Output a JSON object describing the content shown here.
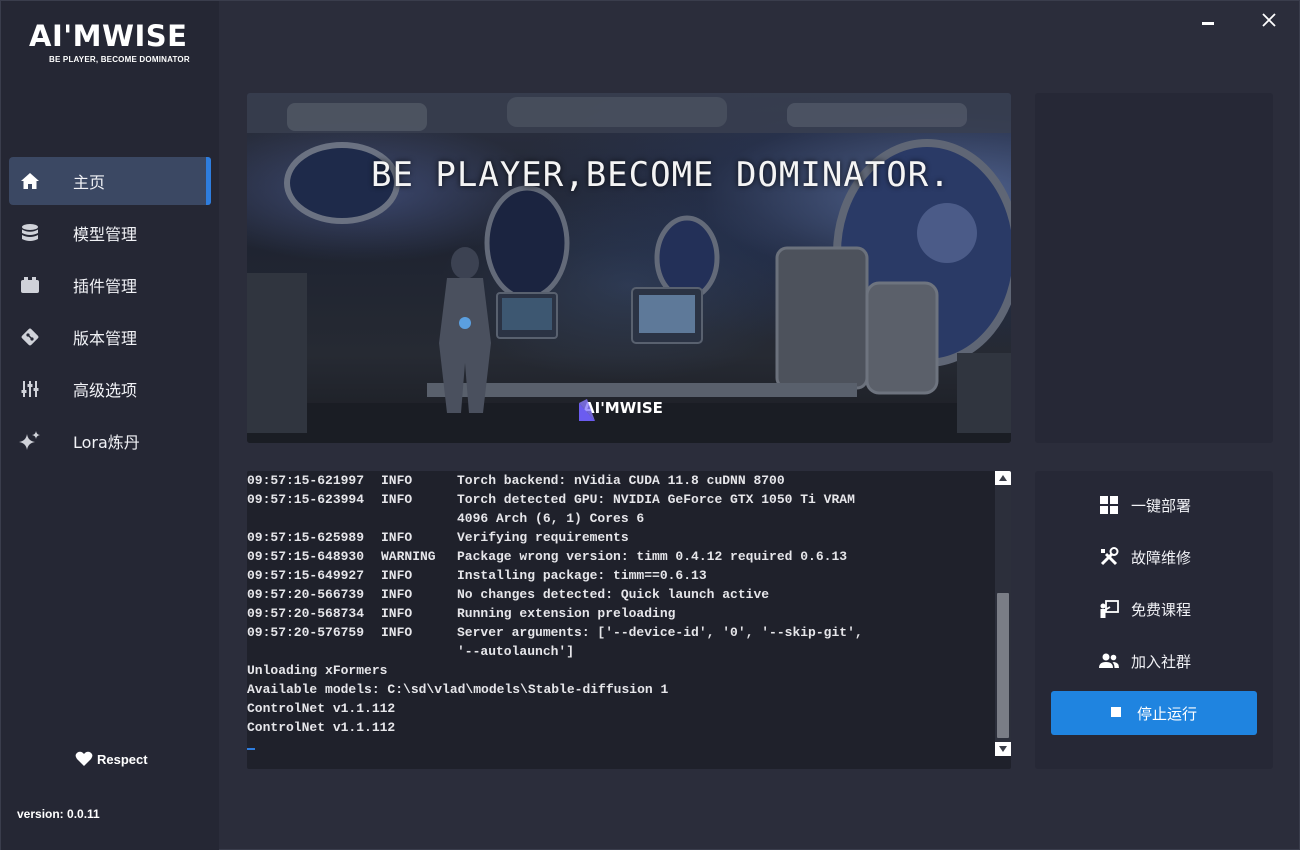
{
  "app": {
    "logo_text": "AI'MWISE",
    "logo_tagline": "BE PLAYER, BECOME DOMINATOR",
    "version": "version: 0.0.11",
    "respect_label": "Respect",
    "accent_color": "#2e7dde"
  },
  "sidebar": {
    "items": [
      {
        "label": "主页",
        "icon": "home-icon",
        "active": true
      },
      {
        "label": "模型管理",
        "icon": "database-icon"
      },
      {
        "label": "插件管理",
        "icon": "plugin-icon"
      },
      {
        "label": "版本管理",
        "icon": "git-icon"
      },
      {
        "label": "高级选项",
        "icon": "sliders-icon"
      },
      {
        "label": "Lora炼丹",
        "icon": "sparkle-icon"
      }
    ]
  },
  "banner": {
    "headline": "BE PLAYER,BECOME DOMINATOR.",
    "logo_text": "AI'MWISE"
  },
  "console": {
    "log_entries": [
      {
        "ts": "09:57:15-621997",
        "level": "INFO",
        "msg": [
          "Torch backend: nVidia CUDA 11.8 cuDNN 8700"
        ]
      },
      {
        "ts": "09:57:15-623994",
        "level": "INFO",
        "msg": [
          "Torch detected GPU: NVIDIA GeForce GTX 1050 Ti VRAM",
          "4096 Arch (6, 1) Cores 6"
        ]
      },
      {
        "ts": "09:57:15-625989",
        "level": "INFO",
        "msg": [
          "Verifying requirements"
        ]
      },
      {
        "ts": "09:57:15-648930",
        "level": "WARNING",
        "msg": [
          "Package wrong version: timm 0.4.12 required 0.6.13"
        ]
      },
      {
        "ts": "09:57:15-649927",
        "level": "INFO",
        "msg": [
          "Installing package: timm==0.6.13"
        ]
      },
      {
        "ts": "09:57:20-566739",
        "level": "INFO",
        "msg": [
          "No changes detected: Quick launch active"
        ]
      },
      {
        "ts": "09:57:20-568734",
        "level": "INFO",
        "msg": [
          "Running extension preloading"
        ]
      },
      {
        "ts": "09:57:20-576759",
        "level": "INFO",
        "msg": [
          "Server arguments: ['--device-id', '0', '--skip-git',",
          "'--autolaunch']"
        ]
      }
    ],
    "plain_lines": [
      "Unloading xFormers",
      "Available models: C:\\sd\\vlad\\models\\Stable-diffusion 1",
      "ControlNet v1.1.112",
      "ControlNet v1.1.112"
    ]
  },
  "actions": {
    "items": [
      {
        "label": "一键部署",
        "icon": "windows-icon"
      },
      {
        "label": "故障维修",
        "icon": "tools-icon"
      },
      {
        "label": "免费课程",
        "icon": "teacher-icon"
      },
      {
        "label": "加入社群",
        "icon": "group-icon"
      }
    ],
    "stop_label": "停止运行",
    "stop_color": "#1f84e0"
  }
}
